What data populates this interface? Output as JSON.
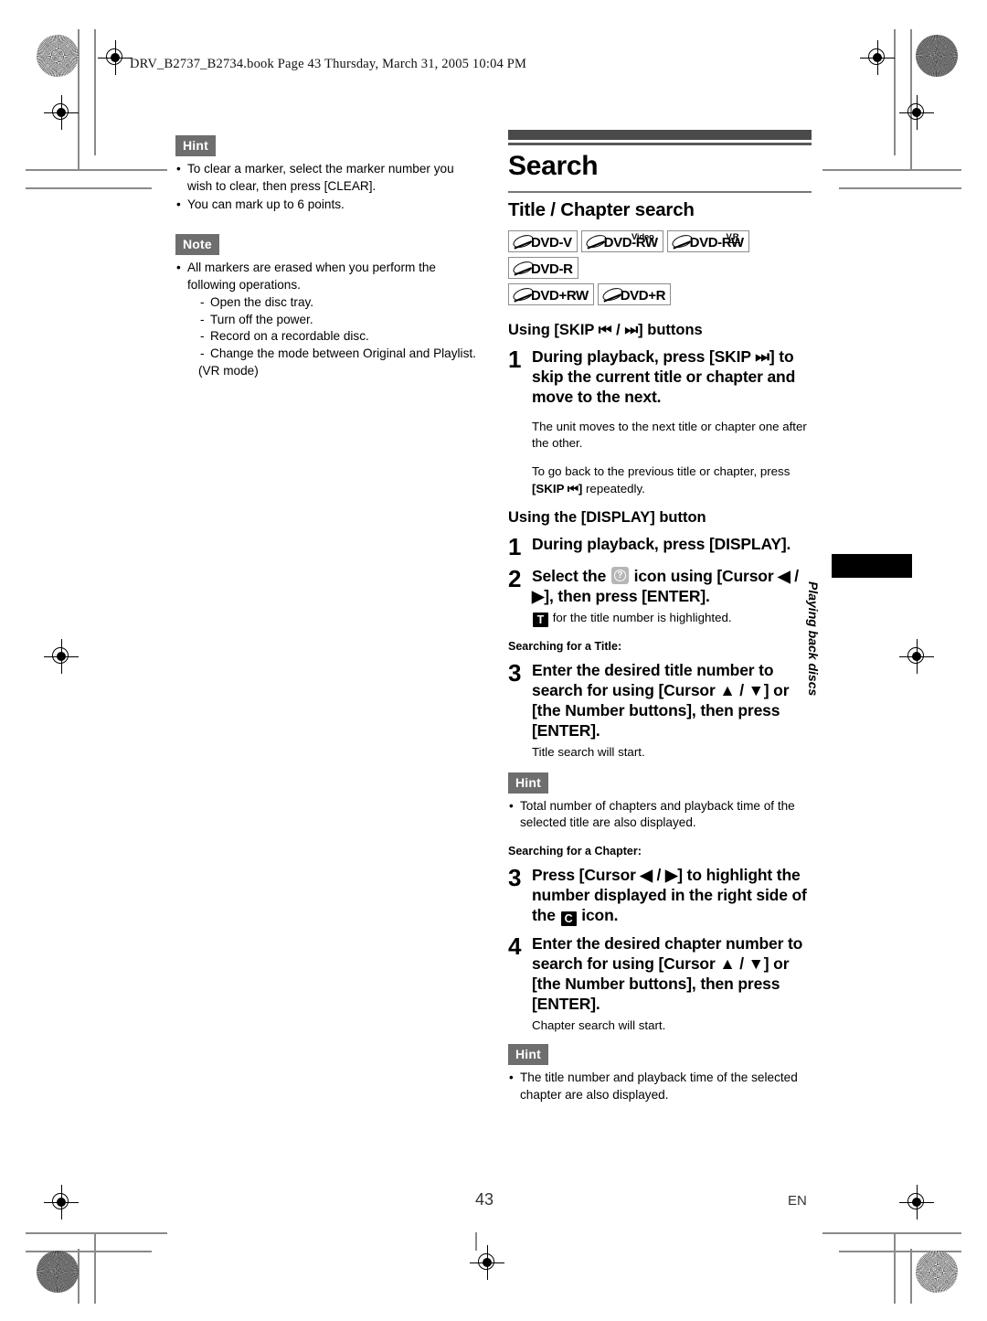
{
  "document": {
    "file_header": "DRV_B2737_B2734.book  Page 43  Thursday, March 31, 2005  10:04 PM",
    "page_number": "43",
    "language_code": "EN",
    "side_tab_label": "Playing back discs"
  },
  "left_column": {
    "hint": {
      "badge": "Hint",
      "bullets": [
        "To clear a marker, select the marker number you wish to clear, then press [CLEAR].",
        "You can mark up to 6 points."
      ]
    },
    "note": {
      "badge": "Note",
      "bullet": "All markers are erased when you perform the following operations.",
      "sub_items": [
        "Open the disc tray.",
        "Turn off the power.",
        "Record on a recordable disc.",
        "Change the mode between Original and Playlist."
      ],
      "trailing_line": "(VR mode)"
    }
  },
  "right_column": {
    "title": "Search",
    "subtitle": "Title / Chapter search",
    "disc_badges": [
      {
        "name": "DVD-V",
        "sup": ""
      },
      {
        "name": "DVD-RW",
        "sup": "Video"
      },
      {
        "name": "DVD-RW",
        "sup": "VR"
      },
      {
        "name": "DVD-R",
        "sup": ""
      },
      {
        "name": "DVD+RW",
        "sup": ""
      },
      {
        "name": "DVD+R",
        "sup": ""
      }
    ],
    "skip_section": {
      "heading": "Using [SKIP ⏮ / ⏭] buttons",
      "step1_num": "1",
      "step1_text": "During playback, press [SKIP ⏭] to skip the current title or chapter and move to the next.",
      "step1_note": "The unit moves to the next title or chapter one after the other.",
      "extra_para_a": "To go back to the previous title or chapter, press",
      "extra_para_b": "[SKIP ⏮]",
      "extra_para_c": " repeatedly."
    },
    "display_section": {
      "heading": "Using the [DISPLAY] button",
      "step1_num": "1",
      "step1_text": "During playback, press [DISPLAY].",
      "step2_num": "2",
      "step2_text_a": "Select the",
      "step2_icon": "search-icon",
      "step2_text_b": "icon using [Cursor ◀ / ▶], then press [ENTER].",
      "step2_note_icon": "T",
      "step2_note_text": "for the title number is highlighted."
    },
    "title_search": {
      "heading": "Searching for a Title:",
      "step3_num": "3",
      "step3_text": "Enter the desired title number to search for using [Cursor ▲ / ▼] or [the Number buttons], then press [ENTER].",
      "step3_note": "Title search will start.",
      "hint_badge": "Hint",
      "hint_bullet": "Total number of chapters and playback time of the selected title are also displayed."
    },
    "chapter_search": {
      "heading": "Searching for a Chapter:",
      "step3_num": "3",
      "step3_text_a": "Press [Cursor ◀ / ▶] to highlight the number displayed in the right side of the",
      "step3_icon": "C",
      "step3_text_b": "icon.",
      "step4_num": "4",
      "step4_text": "Enter the desired chapter number to search for using [Cursor ▲ / ▼] or [the Number buttons], then press [ENTER].",
      "step4_note": "Chapter search will start.",
      "hint_badge": "Hint",
      "hint_bullet": "The title number and playback time of the selected chapter are also displayed."
    }
  }
}
